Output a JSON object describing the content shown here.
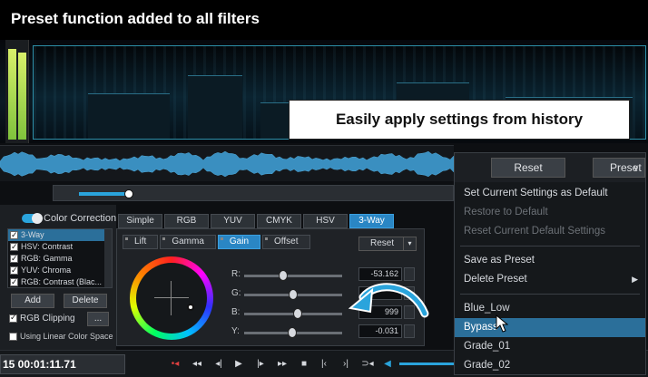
{
  "header": {
    "title": "Preset function added to all filters"
  },
  "callout": {
    "text": "Easily apply settings from history"
  },
  "left_panel": {
    "toggle_label": "Color Correction",
    "filters": [
      {
        "label": "3-Way",
        "checked": true,
        "selected": true
      },
      {
        "label": "HSV: Contrast",
        "checked": true,
        "selected": false
      },
      {
        "label": "RGB: Gamma",
        "checked": true,
        "selected": false
      },
      {
        "label": "YUV: Chroma",
        "checked": true,
        "selected": false
      },
      {
        "label": "RGB: Contrast (Blac...",
        "checked": true,
        "selected": false
      }
    ],
    "add_label": "Add",
    "delete_label": "Delete",
    "rgb_clipping_label": "RGB Clipping",
    "rgb_clipping_checked": true,
    "ellipsis_label": "...",
    "linear_color_space_label": "Using Linear Color Space",
    "linear_color_space_checked": false
  },
  "tabs": [
    "Simple",
    "RGB",
    "YUV",
    "CMYK",
    "HSV",
    "3-Way"
  ],
  "active_tab": "3-Way",
  "subtabs": [
    "Lift",
    "Gamma",
    "Gain",
    "Offset"
  ],
  "active_subtab": "Gain",
  "cc_reset_label": "Reset",
  "channels": [
    {
      "label": "R:",
      "value": "-53.162",
      "level": 0.4
    },
    {
      "label": "G:",
      "value": "",
      "level": 0.5
    },
    {
      "label": "B:",
      "value": "999",
      "level": 0.55
    },
    {
      "label": "Y:",
      "value": "-0.031",
      "level": 0.49
    }
  ],
  "preset_panel": {
    "reset_label": "Reset",
    "preset_label": "Preset",
    "menu": [
      {
        "label": "Set Current Settings as Default",
        "disabled": false
      },
      {
        "label": "Restore to Default",
        "disabled": true
      },
      {
        "label": "Reset Current Default Settings",
        "disabled": true
      },
      {
        "separator": true
      },
      {
        "label": "Save as Preset",
        "disabled": false
      },
      {
        "label": "Delete Preset",
        "disabled": false,
        "submenu": true
      },
      {
        "separator": true
      },
      {
        "label": "Blue_Low",
        "disabled": false
      },
      {
        "label": "Bypass",
        "disabled": false,
        "highlighted": true
      },
      {
        "label": "Grade_01",
        "disabled": false
      },
      {
        "label": "Grade_02",
        "disabled": false
      }
    ]
  },
  "transport": {
    "timecode": "15  00:01:11.71"
  },
  "colors": {
    "accent": "#2aa4dc",
    "highlight": "#2b6f9a",
    "tab_active": "#2a86c4"
  },
  "icons": [
    "chevron-down-icon",
    "submenu-arrow-icon",
    "mouse-pointer-icon",
    "curved-arrow-icon",
    "play-icon",
    "stop-icon",
    "volume-icon"
  ]
}
